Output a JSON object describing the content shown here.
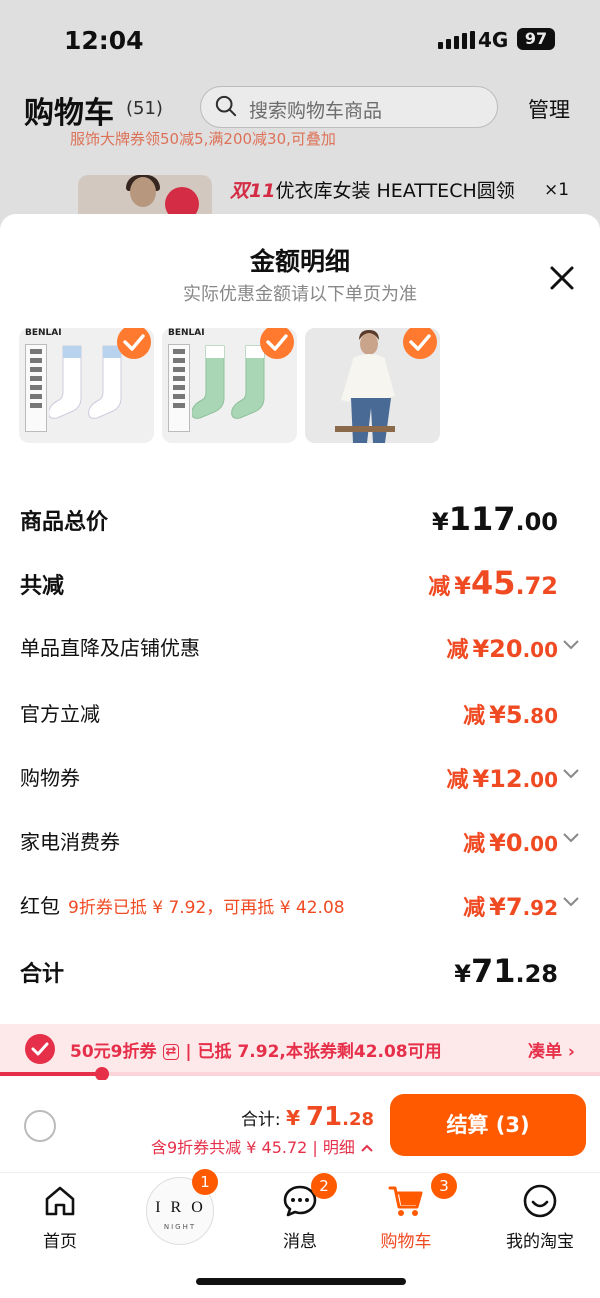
{
  "status_bar": {
    "time": "12:04",
    "network": "4G",
    "battery": "97"
  },
  "header": {
    "title": "购物车",
    "count": "(51)",
    "search_placeholder": "搜索购物车商品",
    "manage": "管理"
  },
  "background_item": {
    "title_prefix": "双11",
    "title": "优衣库女装 HEATTECH圆领",
    "qty": "×1",
    "promo_text": "服饰大牌券领50减5,满200减30,可叠加"
  },
  "sheet": {
    "title": "金额明细",
    "subtitle": "实际优惠金额请以下单页为准",
    "thumb_brand": "BENLAI",
    "rows": [
      {
        "label": "商品总价",
        "prefix": "",
        "symbol": "¥",
        "integer": "117",
        "decimal": ".00",
        "color": "#111111",
        "chevron": false
      },
      {
        "label": "共减",
        "prefix": "减",
        "symbol": "¥",
        "integer": "45",
        "decimal": ".72",
        "color": "#f04a22",
        "chevron": false
      },
      {
        "label": "单品直降及店铺优惠",
        "prefix": "减",
        "symbol": "¥",
        "integer": "20",
        "decimal": ".00",
        "color": "#f04a22",
        "chevron": true
      },
      {
        "label": "官方立减",
        "prefix": "减",
        "symbol": "¥",
        "integer": "5",
        "decimal": ".80",
        "color": "#f04a22",
        "chevron": false
      },
      {
        "label": "购物券",
        "prefix": "减",
        "symbol": "¥",
        "integer": "12",
        "decimal": ".00",
        "color": "#f04a22",
        "chevron": true
      },
      {
        "label": "家电消费券",
        "prefix": "减",
        "symbol": "¥",
        "integer": "0",
        "decimal": ".00",
        "color": "#f04a22",
        "chevron": true
      },
      {
        "label": "红包",
        "note": "9折券已抵 ¥ 7.92，可再抵 ¥ 42.08",
        "prefix": "减",
        "symbol": "¥",
        "integer": "7",
        "decimal": ".92",
        "color": "#f04a22",
        "chevron": true
      },
      {
        "label": "合计",
        "prefix": "",
        "symbol": "¥",
        "integer": "71",
        "decimal": ".28",
        "color": "#111111",
        "chevron": false
      }
    ]
  },
  "coupon": {
    "name": "50元9折券",
    "swap_icon": "⇄",
    "status": "已抵 7.92,本张券剩42.08可用",
    "action": "凑单 ›",
    "progress": 0.17
  },
  "checkout": {
    "total_label": "合计:",
    "total_symbol": "¥",
    "total_integer": "71",
    "total_decimal": ".28",
    "discount_text": "含9折券共减 ¥ 45.72",
    "detail_link": "明细",
    "button": "结算 (3)"
  },
  "tabbar": {
    "tabs": [
      {
        "label": "首页",
        "icon": "home-icon",
        "badge": ""
      },
      {
        "label": "",
        "icon": "iro-night-logo",
        "badge": "1",
        "logo_text": "IRO",
        "logo_sub": "NIGHT"
      },
      {
        "label": "消息",
        "icon": "message-icon",
        "badge": "2"
      },
      {
        "label": "购物车",
        "icon": "cart-icon",
        "badge": "3"
      },
      {
        "label": "我的淘宝",
        "icon": "profile-icon",
        "badge": ""
      }
    ]
  },
  "colors": {
    "accent": "#f04a22",
    "coupon_red": "#e6304a",
    "button_orange": "#ff5a00"
  }
}
